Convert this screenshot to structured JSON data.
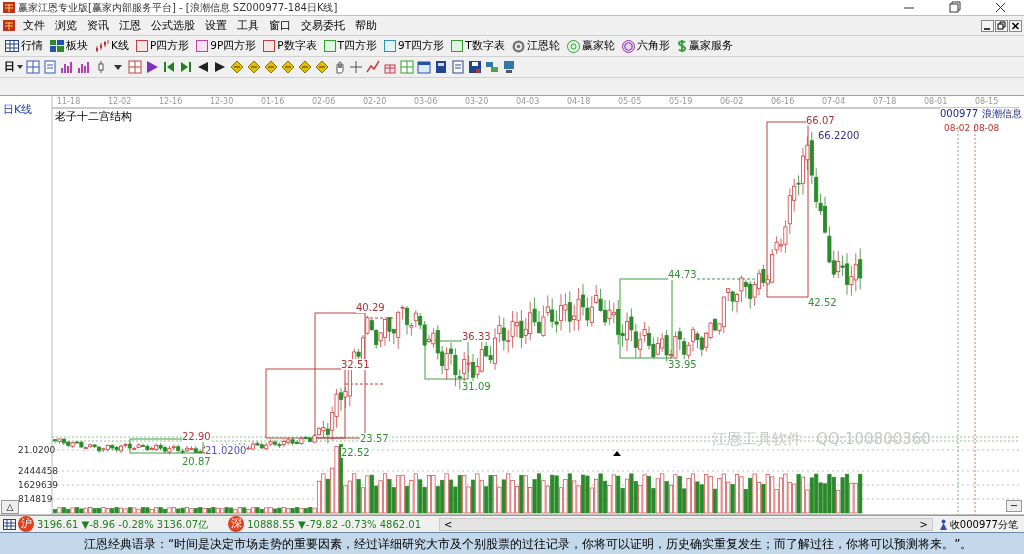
{
  "window": {
    "title": "赢家江恩专业版[赢家内部服务平台] - [浪潮信息  SZ000977-184日K线]"
  },
  "menu": [
    "文件",
    "浏览",
    "资讯",
    "江恩",
    "公式选股",
    "设置",
    "工具",
    "窗口",
    "交易委托",
    "帮助"
  ],
  "toolbar": [
    {
      "label": "行情",
      "kind": "table"
    },
    {
      "label": "板块",
      "kind": "blocks"
    },
    {
      "label": "K线",
      "kind": "candles"
    },
    {
      "label": "P四方形",
      "kind": "red-square"
    },
    {
      "label": "9P四方形",
      "kind": "pink-square"
    },
    {
      "label": "P数字表",
      "kind": "red-square"
    },
    {
      "label": "T四方形",
      "kind": "green-square"
    },
    {
      "label": "9T四方形",
      "kind": "teal-square"
    },
    {
      "label": "T数字表",
      "kind": "green-square"
    },
    {
      "label": "江恩轮",
      "kind": "wheel"
    },
    {
      "label": "赢家轮",
      "kind": "green-wheel"
    },
    {
      "label": "六角形",
      "kind": "hexagon"
    },
    {
      "label": "赢家服务",
      "kind": "dollar"
    }
  ],
  "period": "日",
  "chart": {
    "view": "日K线",
    "title": "老子十二宫结构",
    "dates": [
      "11-18",
      "12-02",
      "12-16",
      "12-30",
      "01-16",
      "02-06",
      "02-20",
      "03-06",
      "03-20",
      "04-03",
      "04-18",
      "05-05",
      "05-19",
      "06-02",
      "06-16",
      "07-04",
      "07-18",
      "08-01",
      "08-15"
    ],
    "stock_code": "000977",
    "stock_name": "浪潮信息",
    "marker_dates": [
      "08-02",
      "08-08"
    ],
    "price_labels": [
      {
        "text": "66.07",
        "color": "#b03030"
      },
      {
        "text": "66.2200",
        "color": "#303080"
      },
      {
        "text": "44.73",
        "color": "#309030"
      },
      {
        "text": "42.52",
        "color": "#309030"
      },
      {
        "text": "40.29",
        "color": "#b03030"
      },
      {
        "text": "36.33",
        "color": "#b03030"
      },
      {
        "text": "32.51",
        "color": "#b03030"
      },
      {
        "text": "33.95",
        "color": "#309030"
      },
      {
        "text": "31.09",
        "color": "#309030"
      },
      {
        "text": "22.90",
        "color": "#b03030"
      },
      {
        "text": "23.57",
        "color": "#309030"
      },
      {
        "text": "22.52",
        "color": "#309030"
      },
      {
        "text": "21.0200",
        "color": "#5050b0"
      },
      {
        "text": "20.87",
        "color": "#309030"
      }
    ],
    "axis_price": "21.0200",
    "volume_ticks": [
      "2444458",
      "1629639",
      "814819"
    ],
    "overlay_text": "江恩工具软件   QQ:100800360",
    "expand_button": "△",
    "collapse_button": "−"
  },
  "status": {
    "markets": [
      {
        "badge": "沪",
        "text": "3196.61 ▼-8.96 -0.28% 3136.07亿"
      },
      {
        "badge": "深",
        "text": "10888.55 ▼-79.82 -0.73% 4862.01"
      }
    ],
    "scroll_left": "<",
    "scroll_right": ">",
    "tick_button": "收000977分笔"
  },
  "quote": "江恩经典语录：“时间是决定市场走势的重要因素，经过详细研究大市及个别股票的过往记录，你将可以证明，历史确实重复发生；而了解过往，你将可以预测将来。”。"
}
